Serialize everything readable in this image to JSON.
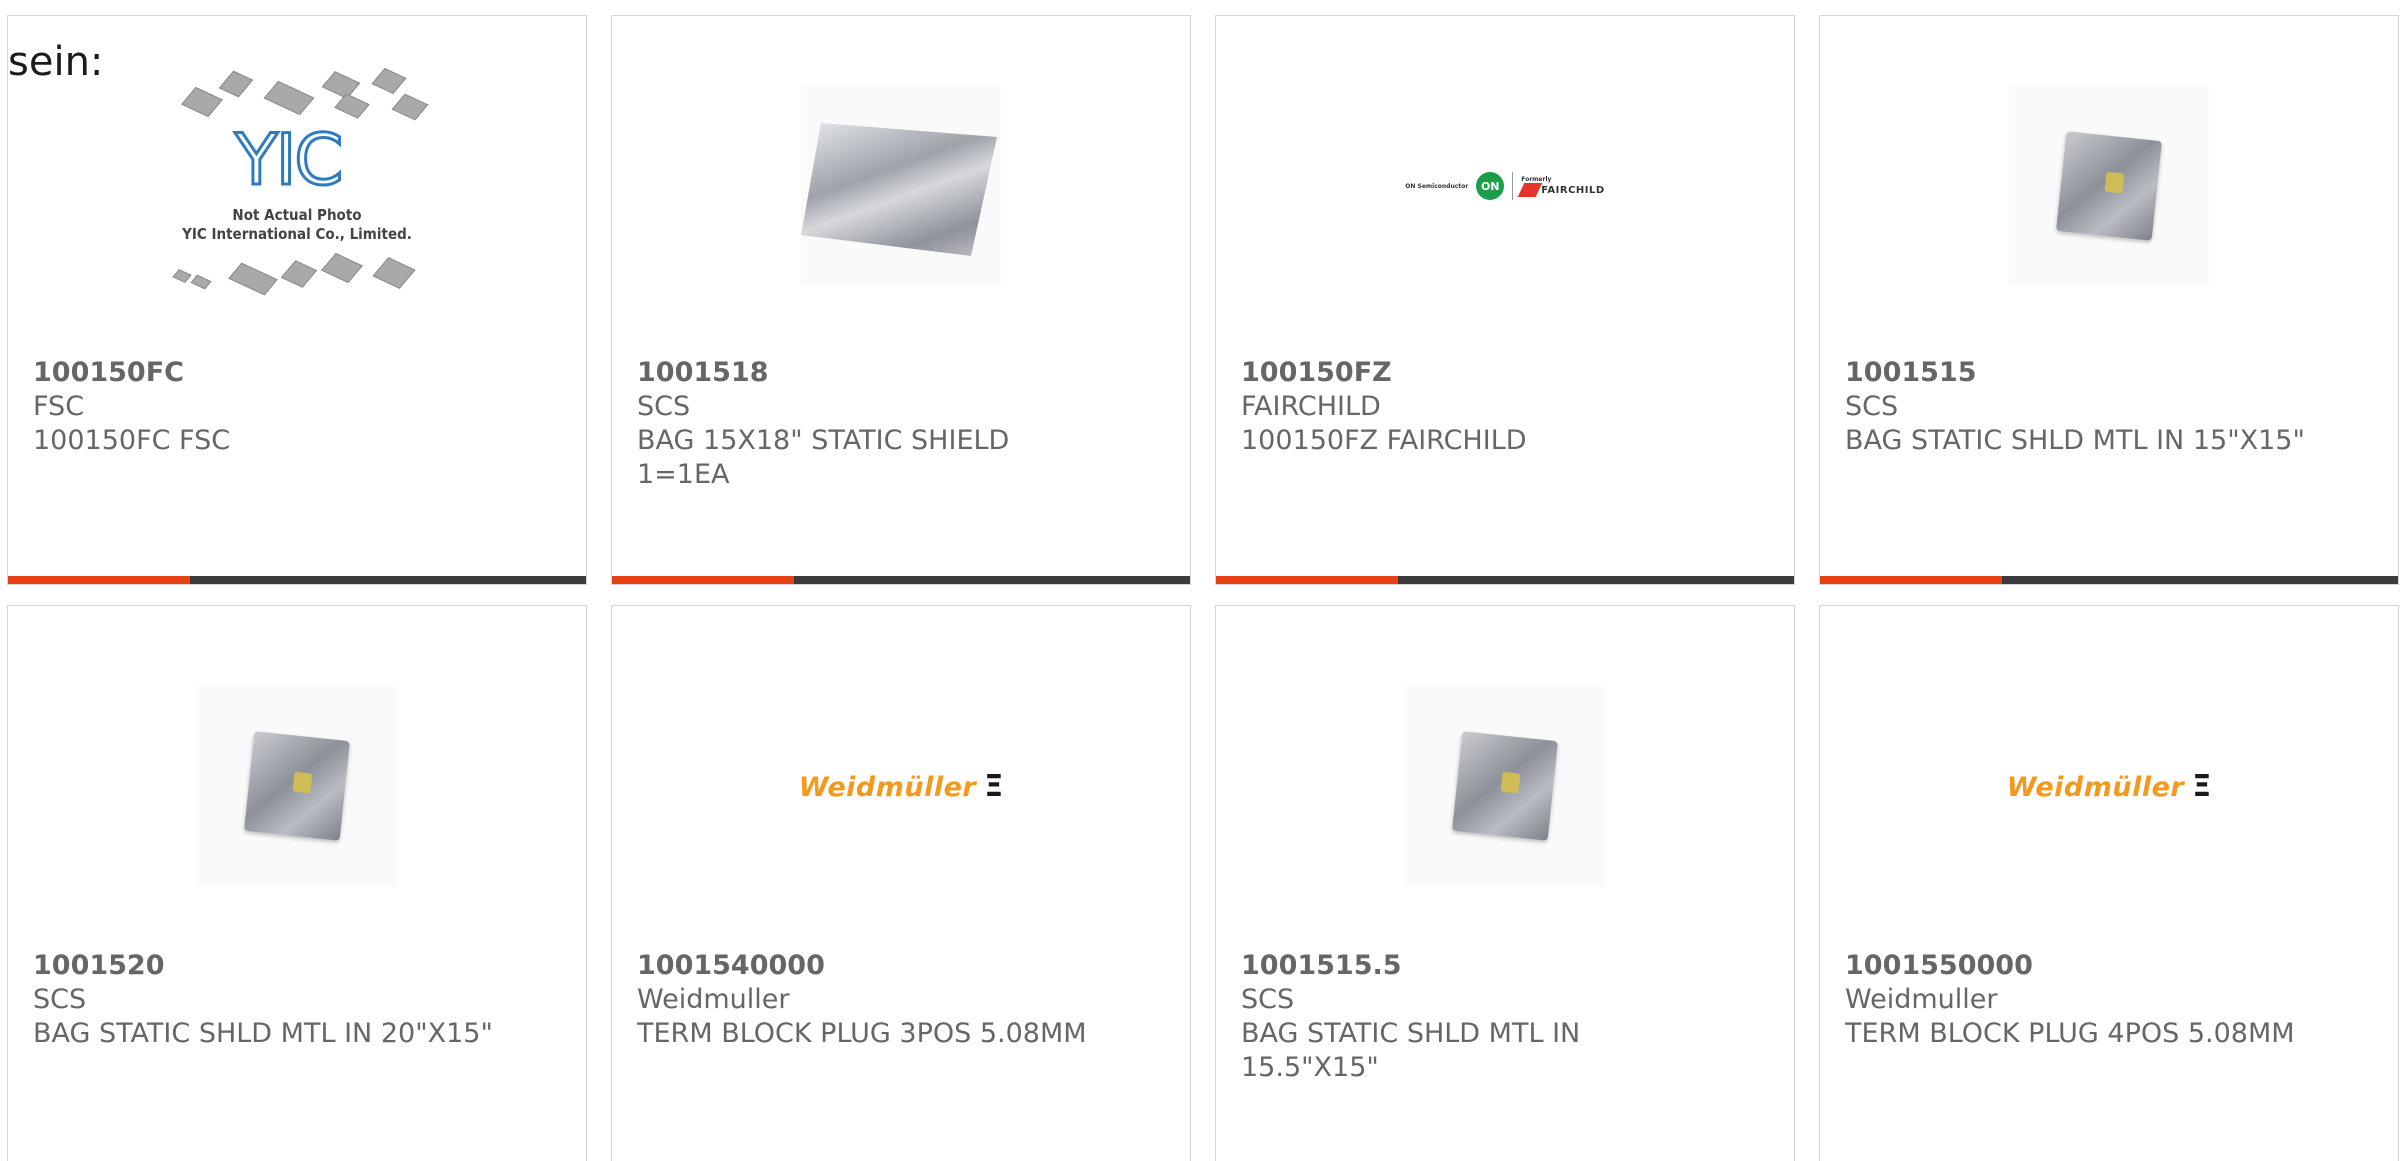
{
  "heading_fragment": "sein:",
  "colors": {
    "accent": "#e84118",
    "bar": "#3c3c3c",
    "text": "#666666"
  },
  "products": [
    {
      "part_number": "100150FC",
      "manufacturer": "FSC",
      "description": "100150FC FSC",
      "image": "yic-placeholder",
      "image_caption_1": "Not Actual Photo",
      "image_caption_2": "YIC International Co., Limited.",
      "image_logo": "YIC"
    },
    {
      "part_number": "1001518",
      "manufacturer": "SCS",
      "description": "BAG 15X18\" STATIC SHIELD 1=1EA",
      "image": "static-bag-large"
    },
    {
      "part_number": "100150FZ",
      "manufacturer": "FAIRCHILD",
      "description": "100150FZ FAIRCHILD",
      "image": "fairchild-logo",
      "logo_on_text": "ON",
      "logo_on_small": "ON Semiconductor",
      "logo_formerly": "Formerly",
      "logo_fairchild": "FAIRCHILD"
    },
    {
      "part_number": "1001515",
      "manufacturer": "SCS",
      "description": "BAG STATIC SHLD MTL IN 15\"X15\"",
      "image": "static-bag"
    },
    {
      "part_number": "1001520",
      "manufacturer": "SCS",
      "description": "BAG STATIC SHLD MTL IN 20\"X15\"",
      "image": "static-bag"
    },
    {
      "part_number": "1001540000",
      "manufacturer": "Weidmuller",
      "description": "TERM BLOCK PLUG 3POS 5.08MM",
      "image": "weidmuller-logo",
      "logo_text": "Weidmüller",
      "logo_mark": "Ξ"
    },
    {
      "part_number": "1001515.5",
      "manufacturer": "SCS",
      "description": "BAG STATIC SHLD MTL IN 15.5\"X15\"",
      "image": "static-bag"
    },
    {
      "part_number": "1001550000",
      "manufacturer": "Weidmuller",
      "description": "TERM BLOCK PLUG 4POS 5.08MM",
      "image": "weidmuller-logo",
      "logo_text": "Weidmüller",
      "logo_mark": "Ξ"
    }
  ]
}
